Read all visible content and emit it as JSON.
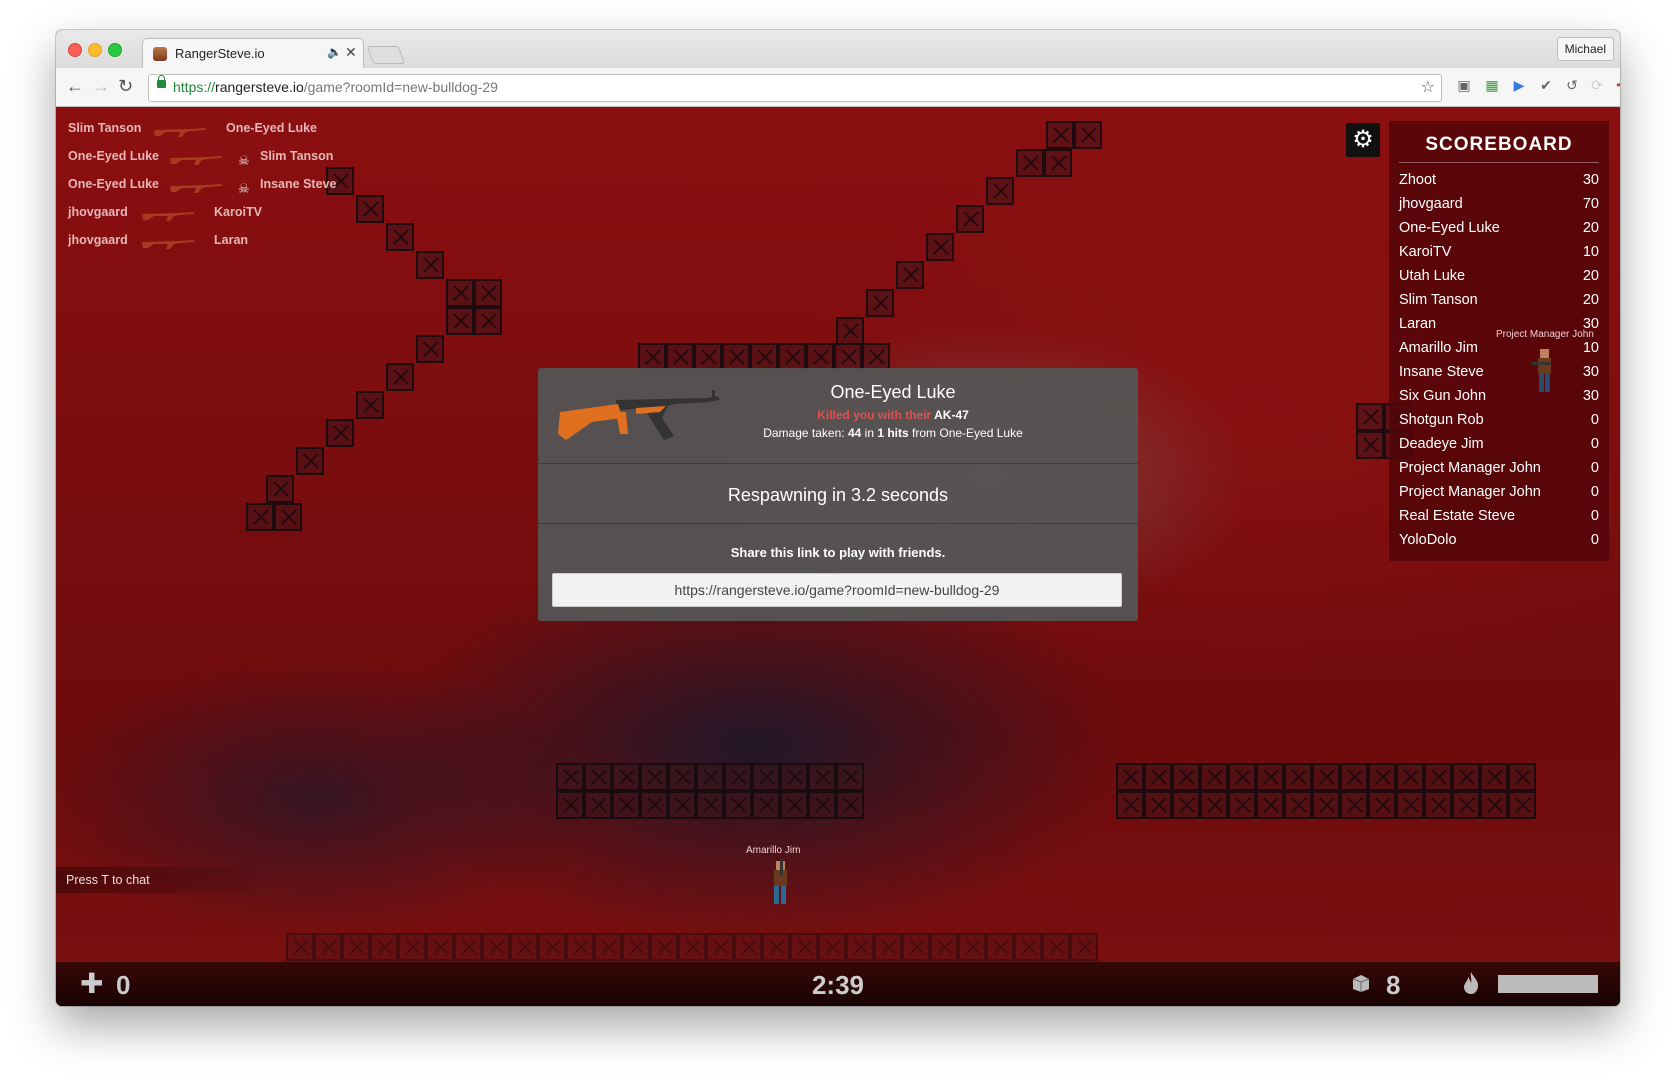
{
  "browser": {
    "tab_title": "RangerSteve.io",
    "profile": "Michael",
    "url_scheme": "https://",
    "url_host": "rangersteve.io",
    "url_path": "/game?roomId=new-bulldog-29"
  },
  "killfeed": [
    {
      "killer": "Slim Tanson",
      "victim": "One-Eyed Luke",
      "headshot": false
    },
    {
      "killer": "One-Eyed Luke",
      "victim": "Slim Tanson",
      "headshot": true
    },
    {
      "killer": "One-Eyed Luke",
      "victim": "Insane Steve",
      "headshot": true
    },
    {
      "killer": "jhovgaard",
      "victim": "KaroiTV",
      "headshot": false
    },
    {
      "killer": "jhovgaard",
      "victim": "Laran",
      "headshot": false
    }
  ],
  "scoreboard": {
    "title": "SCOREBOARD",
    "players": [
      {
        "name": "Zhoot",
        "score": "30"
      },
      {
        "name": "jhovgaard",
        "score": "70"
      },
      {
        "name": "One-Eyed Luke",
        "score": "20"
      },
      {
        "name": "KaroiTV",
        "score": "10"
      },
      {
        "name": "Utah Luke",
        "score": "20"
      },
      {
        "name": "Slim Tanson",
        "score": "20"
      },
      {
        "name": "Laran",
        "score": "30"
      },
      {
        "name": "Amarillo Jim",
        "score": "10"
      },
      {
        "name": "Insane Steve",
        "score": "30"
      },
      {
        "name": "Six Gun John",
        "score": "30"
      },
      {
        "name": "Shotgun Rob",
        "score": "0"
      },
      {
        "name": "Deadeye Jim",
        "score": "0"
      },
      {
        "name": "Project Manager John",
        "score": "0"
      },
      {
        "name": "Project Manager John",
        "score": "0"
      },
      {
        "name": "Real Estate Steve",
        "score": "0"
      },
      {
        "name": "YoloDolo",
        "score": "0"
      }
    ]
  },
  "death": {
    "killer": "One-Eyed Luke",
    "killed_prefix": "Killed you with their",
    "weapon": "AK-47",
    "damage_label": "Damage taken:",
    "damage": "44",
    "in_label": "in",
    "hits": "1 hits",
    "from_label": "from",
    "respawn": "Respawning in 3.2 seconds",
    "share_label": "Share this link to play with friends.",
    "share_link": "https://rangersteve.io/game?roomId=new-bulldog-29"
  },
  "players_on_map": [
    {
      "name": "Amarillo Jim"
    },
    {
      "name": "Project Manager John"
    }
  ],
  "hud": {
    "chat_hint": "Press T to chat",
    "health": "0",
    "timer": "2:39",
    "ammo": "8"
  },
  "colors": {
    "accent_red": "#e05050",
    "gun_orange": "#e07020"
  }
}
